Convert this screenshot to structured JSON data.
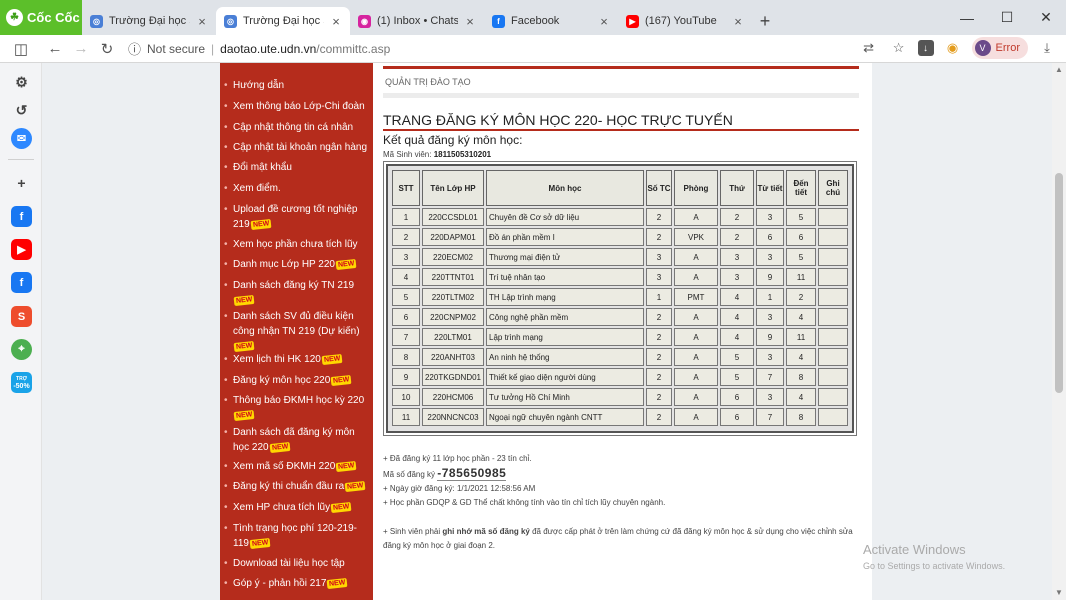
{
  "browser": {
    "brand": "Cốc Cốc",
    "tabs": [
      {
        "label": "Trường Đại học Sư phạm K",
        "favicon_color": "#4a7fd6",
        "active": false
      },
      {
        "label": "Trường Đại học Sư phạm K",
        "favicon_color": "#4a7fd6",
        "active": true
      },
      {
        "label": "(1) Inbox • Chats",
        "favicon_color": "#d6249f",
        "active": false
      },
      {
        "label": "Facebook",
        "favicon_color": "#1877f2",
        "active": false
      },
      {
        "label": "(167) YouTube",
        "favicon_color": "#ff0000",
        "active": false
      }
    ],
    "security": "Not secure",
    "url_host": "daotao.ute.udn.vn",
    "url_path": "/committc.asp",
    "error_label": "Error",
    "avatar_letter": "V"
  },
  "sidebar_icons": [
    "settings-icon",
    "history-icon",
    "messenger-icon",
    "add-icon",
    "facebook-icon",
    "youtube-icon",
    "facebook-icon",
    "shopee-icon",
    "map-icon",
    "sale-icon"
  ],
  "sale_badge": {
    "line1": "TRỢ",
    "line2": "-50%"
  },
  "menu": {
    "new_badge": "NEW",
    "items": [
      {
        "label": "Hướng dẫn",
        "new": false
      },
      {
        "label": "Xem thông báo Lớp-Chi đoàn",
        "new": false
      },
      {
        "label": "Cập nhật thông tin cá nhân",
        "new": false
      },
      {
        "label": "Cập nhật tài khoản ngân hàng",
        "new": false
      },
      {
        "label": "Đổi mật khẩu",
        "new": false
      },
      {
        "label": "Xem điểm.",
        "new": false
      },
      {
        "label": "Upload đề cương tốt nghiệp 219",
        "new": true
      },
      {
        "label": "Xem học phần chưa tích lũy",
        "new": false
      },
      {
        "label": "Danh mục Lớp HP 220",
        "new": true
      },
      {
        "label": "Danh sách đăng ký TN 219",
        "new": true
      },
      {
        "label": "Danh sách SV đủ điều kiện công nhận TN 219 (Dự kiến)",
        "new": true
      },
      {
        "label": "Xem lịch thi HK 120",
        "new": true
      },
      {
        "label": "Đăng ký môn học 220",
        "new": true
      },
      {
        "label": "Thông báo ĐKMH học kỳ 220",
        "new": true
      },
      {
        "label": "Danh sách đã đăng ký môn học 220",
        "new": true
      },
      {
        "label": "Xem mã số ĐKMH 220",
        "new": true
      },
      {
        "label": "Đăng ký thi chuẩn đầu ra",
        "new": true
      },
      {
        "label": "Xem HP chưa tích lũy",
        "new": true
      },
      {
        "label": "Tình trạng học phí 120-219-119",
        "new": true
      },
      {
        "label": "Download tài liệu học tập",
        "new": false
      },
      {
        "label": "Góp ý - phản hồi 217",
        "new": true
      }
    ]
  },
  "page": {
    "breadcrumb": "QUẢN TRỊ ĐÀO TẠO",
    "title": "TRANG ĐĂNG KÝ MÔN HỌC 220- HỌC TRỰC TUYẾN",
    "subtitle": "Kết quả đăng ký môn học:",
    "student_label": "Mã Sinh viên:",
    "student_id": "1811505310201"
  },
  "table": {
    "headers": [
      "STT",
      "Tên Lớp HP",
      "Môn học",
      "Số TC",
      "Phòng",
      "Thứ",
      "Từ tiết",
      "Đến tiết",
      "Ghi chú"
    ],
    "rows": [
      [
        "1",
        "220CCSDL01",
        "Chuyên đề Cơ sở dữ liệu",
        "2",
        "A",
        "2",
        "3",
        "5",
        ""
      ],
      [
        "2",
        "220DAPM01",
        "Đồ án phần mềm I",
        "2",
        "VPK",
        "2",
        "6",
        "6",
        ""
      ],
      [
        "3",
        "220ECM02",
        "Thương mại điện tử",
        "3",
        "A",
        "3",
        "3",
        "5",
        ""
      ],
      [
        "4",
        "220TTNT01",
        "Trí tuệ nhân tạo",
        "3",
        "A",
        "3",
        "9",
        "11",
        ""
      ],
      [
        "5",
        "220TLTM02",
        "TH Lập trình mạng",
        "1",
        "PMT",
        "4",
        "1",
        "2",
        ""
      ],
      [
        "6",
        "220CNPM02",
        "Công nghệ phần mềm",
        "2",
        "A",
        "4",
        "3",
        "4",
        ""
      ],
      [
        "7",
        "220LTM01",
        "Lập trình mạng",
        "2",
        "A",
        "4",
        "9",
        "11",
        ""
      ],
      [
        "8",
        "220ANHT03",
        "An ninh hệ thống",
        "2",
        "A",
        "5",
        "3",
        "4",
        ""
      ],
      [
        "9",
        "220TKGDND01",
        "Thiết kế giao diện người dùng",
        "2",
        "A",
        "5",
        "7",
        "8",
        ""
      ],
      [
        "10",
        "220HCM06",
        "Tư tưởng Hồ Chí Minh",
        "2",
        "A",
        "6",
        "3",
        "4",
        ""
      ],
      [
        "11",
        "220NNCNC03",
        "Ngoại ngữ chuyên ngành CNTT",
        "2",
        "A",
        "6",
        "7",
        "8",
        ""
      ]
    ]
  },
  "notes": {
    "summary": "+ Đã đăng ký 11 lớp học phần - 23 tín chỉ.",
    "code_label": "Mã số đăng ký",
    "code_value": "-785650985",
    "date_line": "+ Ngày giờ đăng ký: 1/1/2021 12:58:56 AM",
    "gdqp_line": "+ Học phần GDQP & GD Thể chất không tính vào tín chỉ tích lũy chuyên ngành.",
    "remember_prefix": "+ Sinh viên phải",
    "remember_bold": "ghi nhớ mã số đăng ký",
    "remember_suffix": "đã được cấp phát ở trên làm chứng cứ đã đăng ký môn học & sử dụng cho việc chỉnh sửa đăng ký môn học ở giai đoạn 2."
  },
  "watermark": {
    "title": "Activate Windows",
    "sub": "Go to Settings to activate Windows."
  },
  "colors": {
    "brand_green": "#5cbf2a",
    "menu_red": "#b52c1c",
    "new_badge": "#ffd700"
  }
}
